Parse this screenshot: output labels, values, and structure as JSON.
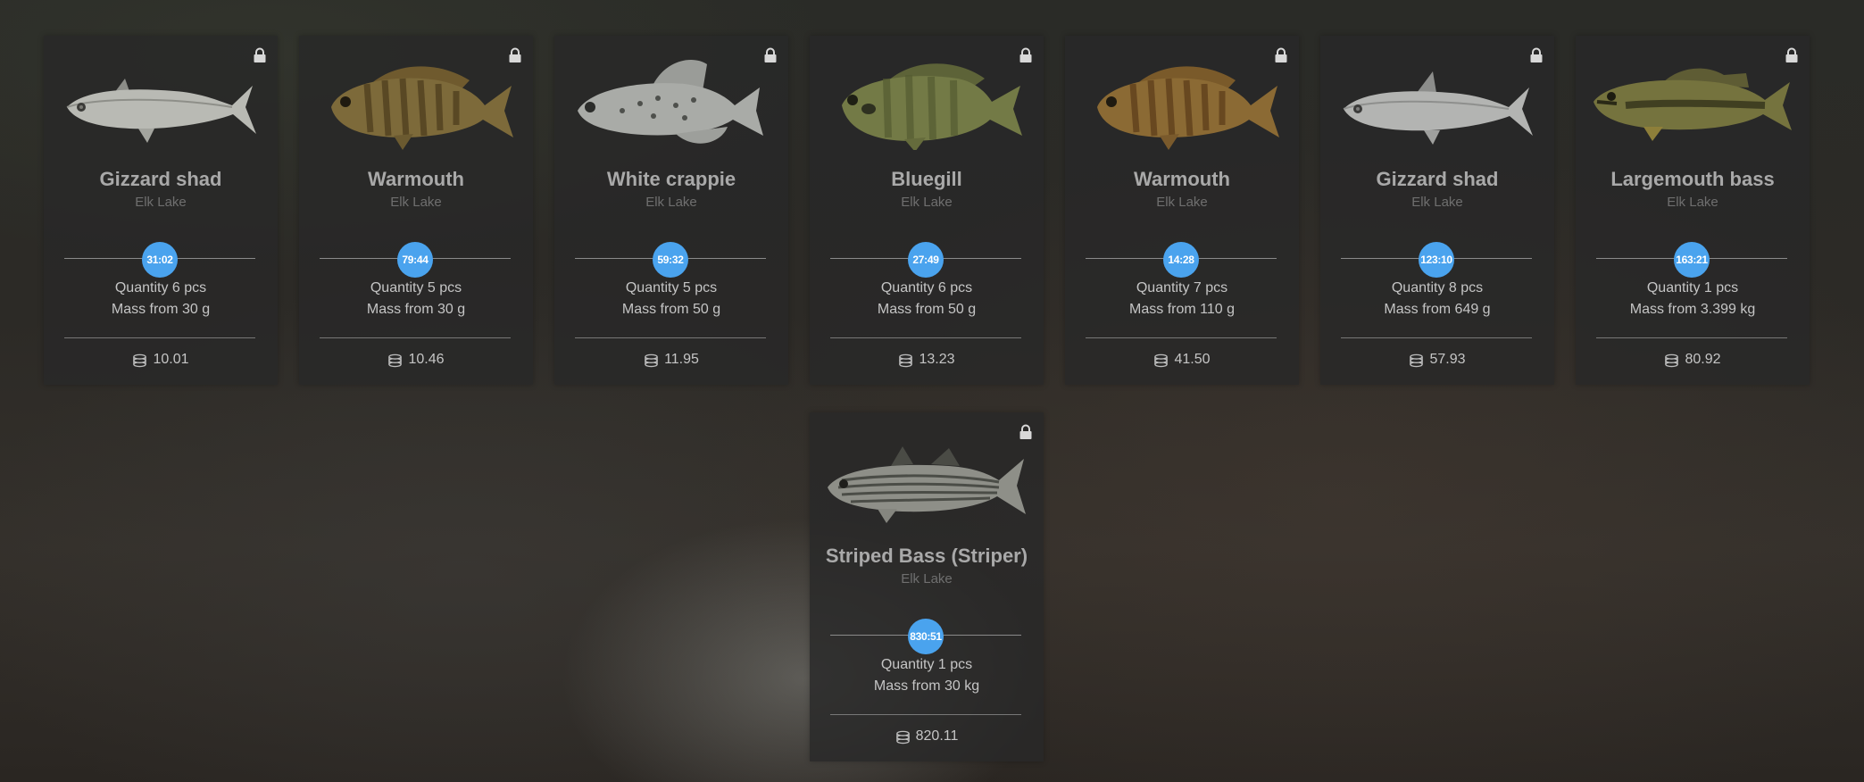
{
  "colors": {
    "timer_badge": "#4aa3ee",
    "card_bg": "#282828",
    "name_text": "#a9a9a9",
    "lake_text": "#6f6f6f",
    "info_text": "#c5c5c5"
  },
  "labels": {
    "quantity_prefix": "Quantity",
    "mass_prefix": "Mass from"
  },
  "cards": [
    {
      "name": "Gizzard shad",
      "lake": "Elk Lake",
      "timer": "31:02",
      "quantity": "Quantity 6 pcs",
      "mass": "Mass from 30 g",
      "price": "10.01",
      "locked": true,
      "icon": "lock-icon",
      "price_icon": "coins-icon"
    },
    {
      "name": "Warmouth",
      "lake": "Elk Lake",
      "timer": "79:44",
      "quantity": "Quantity 5 pcs",
      "mass": "Mass from 30 g",
      "price": "10.46",
      "locked": true,
      "icon": "lock-icon",
      "price_icon": "coins-icon"
    },
    {
      "name": "White crappie",
      "lake": "Elk Lake",
      "timer": "59:32",
      "quantity": "Quantity 5 pcs",
      "mass": "Mass from 50 g",
      "price": "11.95",
      "locked": true,
      "icon": "lock-icon",
      "price_icon": "coins-icon"
    },
    {
      "name": "Bluegill",
      "lake": "Elk Lake",
      "timer": "27:49",
      "quantity": "Quantity 6 pcs",
      "mass": "Mass from 50 g",
      "price": "13.23",
      "locked": true,
      "icon": "lock-icon",
      "price_icon": "coins-icon"
    },
    {
      "name": "Warmouth",
      "lake": "Elk Lake",
      "timer": "14:28",
      "quantity": "Quantity 7 pcs",
      "mass": "Mass from 110 g",
      "price": "41.50",
      "locked": true,
      "icon": "lock-icon",
      "price_icon": "coins-icon"
    },
    {
      "name": "Gizzard shad",
      "lake": "Elk Lake",
      "timer": "123:10",
      "quantity": "Quantity 8 pcs",
      "mass": "Mass from 649 g",
      "price": "57.93",
      "locked": true,
      "icon": "lock-icon",
      "price_icon": "coins-icon"
    },
    {
      "name": "Largemouth bass",
      "lake": "Elk Lake",
      "timer": "163:21",
      "quantity": "Quantity 1 pcs",
      "mass": "Mass from 3.399 kg",
      "price": "80.92",
      "locked": true,
      "icon": "lock-icon",
      "price_icon": "coins-icon"
    },
    {
      "name": "Striped Bass (Striper)",
      "lake": "Elk Lake",
      "timer": "830:51",
      "quantity": "Quantity 1 pcs",
      "mass": "Mass from 30 kg",
      "price": "820.11",
      "locked": true,
      "icon": "lock-icon",
      "price_icon": "coins-icon"
    }
  ]
}
